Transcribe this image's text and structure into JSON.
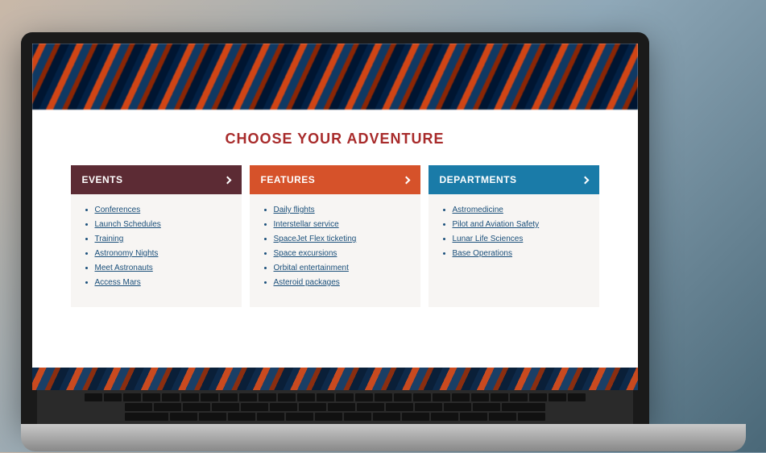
{
  "heading": "CHOOSE YOUR ADVENTURE",
  "cards": [
    {
      "title": "EVENTS",
      "color": "maroon",
      "items": [
        "Conferences",
        "Launch Schedules",
        "Training",
        "Astronomy Nights",
        "Meet Astronauts",
        "Access Mars"
      ]
    },
    {
      "title": "FEATURES",
      "color": "orange",
      "items": [
        "Daily flights",
        "Interstellar service",
        "SpaceJet Flex ticketing",
        "Space excursions",
        "Orbital entertainment",
        "Asteroid packages"
      ]
    },
    {
      "title": "DEPARTMENTS",
      "color": "blue",
      "items": [
        "Astromedicine",
        "Pilot and Aviation Safety",
        "Lunar Life Sciences",
        "Base Operations"
      ]
    }
  ]
}
